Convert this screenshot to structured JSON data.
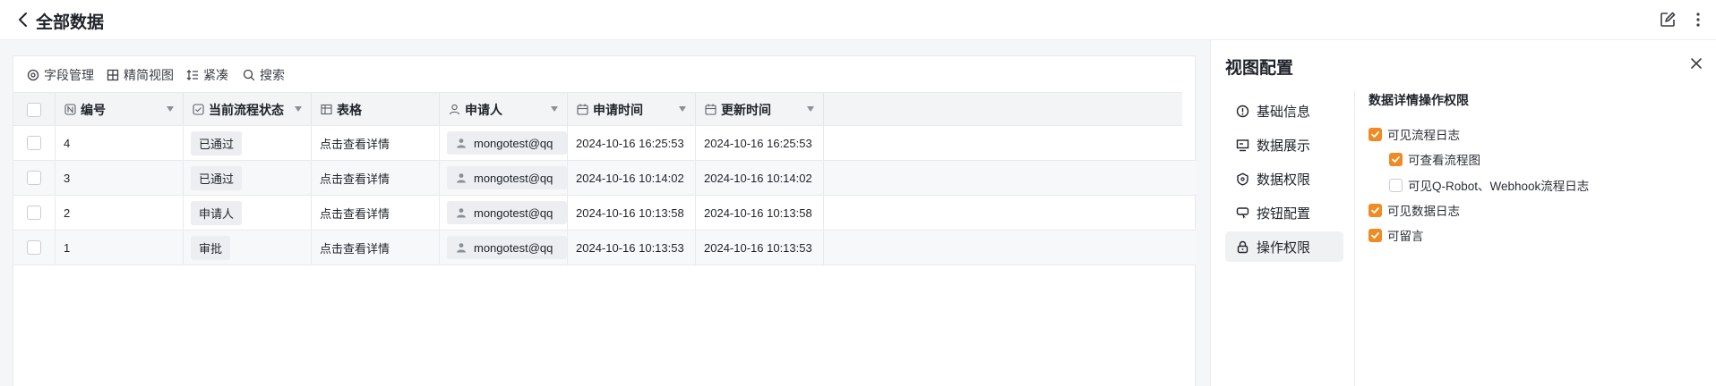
{
  "header": {
    "title": "全部数据"
  },
  "toolbar": {
    "field_manage": "字段管理",
    "simple_view": "精简视图",
    "compact": "紧凑",
    "search": "搜索"
  },
  "table": {
    "columns": [
      "编号",
      "当前流程状态",
      "表格",
      "申请人",
      "申请时间",
      "更新时间"
    ],
    "rows": [
      {
        "id": "4",
        "status": "已通过",
        "table": "点击查看详情",
        "applicant": "mongotest@qq",
        "apply_time": "2024-10-16 16:25:53",
        "update_time": "2024-10-16 16:25:53"
      },
      {
        "id": "3",
        "status": "已通过",
        "table": "点击查看详情",
        "applicant": "mongotest@qq",
        "apply_time": "2024-10-16 10:14:02",
        "update_time": "2024-10-16 10:14:02"
      },
      {
        "id": "2",
        "status": "申请人",
        "table": "点击查看详情",
        "applicant": "mongotest@qq",
        "apply_time": "2024-10-16 10:13:58",
        "update_time": "2024-10-16 10:13:58"
      },
      {
        "id": "1",
        "status": "审批",
        "table": "点击查看详情",
        "applicant": "mongotest@qq",
        "apply_time": "2024-10-16 10:13:53",
        "update_time": "2024-10-16 10:13:53"
      }
    ]
  },
  "panel": {
    "title": "视图配置",
    "menu": [
      "基础信息",
      "数据展示",
      "数据权限",
      "按钮配置",
      "操作权限"
    ],
    "active_menu": "操作权限",
    "section_title": "数据详情操作权限",
    "options": [
      {
        "label": "可见流程日志",
        "checked": true
      },
      {
        "label": "可查看流程图",
        "checked": true
      },
      {
        "label": "可见Q-Robot、Webhook流程日志",
        "checked": false
      },
      {
        "label": "可见数据日志",
        "checked": true
      },
      {
        "label": "可留言",
        "checked": true
      }
    ]
  },
  "colors": {
    "accent": "#f08a24",
    "text": "#1f2329",
    "header_bg": "#f3f4f6"
  }
}
